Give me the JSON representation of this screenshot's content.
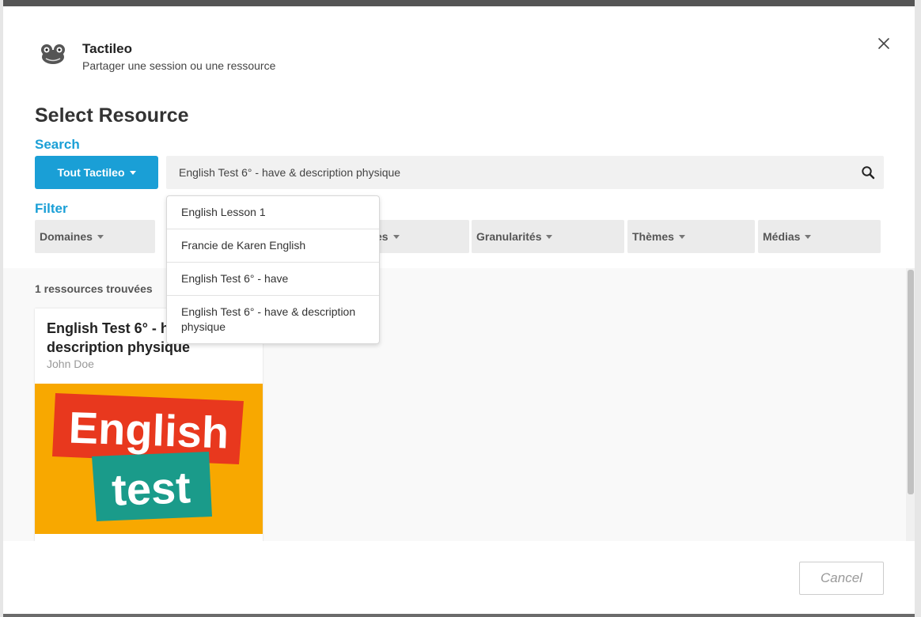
{
  "app": {
    "name": "Tactileo",
    "subtitle": "Partager une session ou une ressource"
  },
  "page": {
    "title": "Select Resource",
    "search_label": "Search",
    "filter_label": "Filter"
  },
  "search": {
    "scope_label": "Tout Tactileo",
    "value": "English Test 6° - have & description physique"
  },
  "autocomplete": [
    "English Lesson 1",
    "Francie de Karen English",
    "English Test 6° - have",
    "English Test 6° - have & description physique"
  ],
  "filters": [
    "Domaines",
    "es",
    "Granularités",
    "Thèmes",
    "Médias"
  ],
  "results": {
    "count_label": "1 ressources trouvées",
    "card": {
      "title": "English Test 6° - have & description physique",
      "author": "John Doe",
      "thumb_line1": "English",
      "thumb_line2": "test"
    }
  },
  "footer": {
    "cancel_label": "Cancel"
  },
  "colors": {
    "accent": "#1a9fd6",
    "thumb_bg": "#f8a800",
    "thumb_red": "#e8381e",
    "thumb_teal": "#1a9b8a"
  }
}
